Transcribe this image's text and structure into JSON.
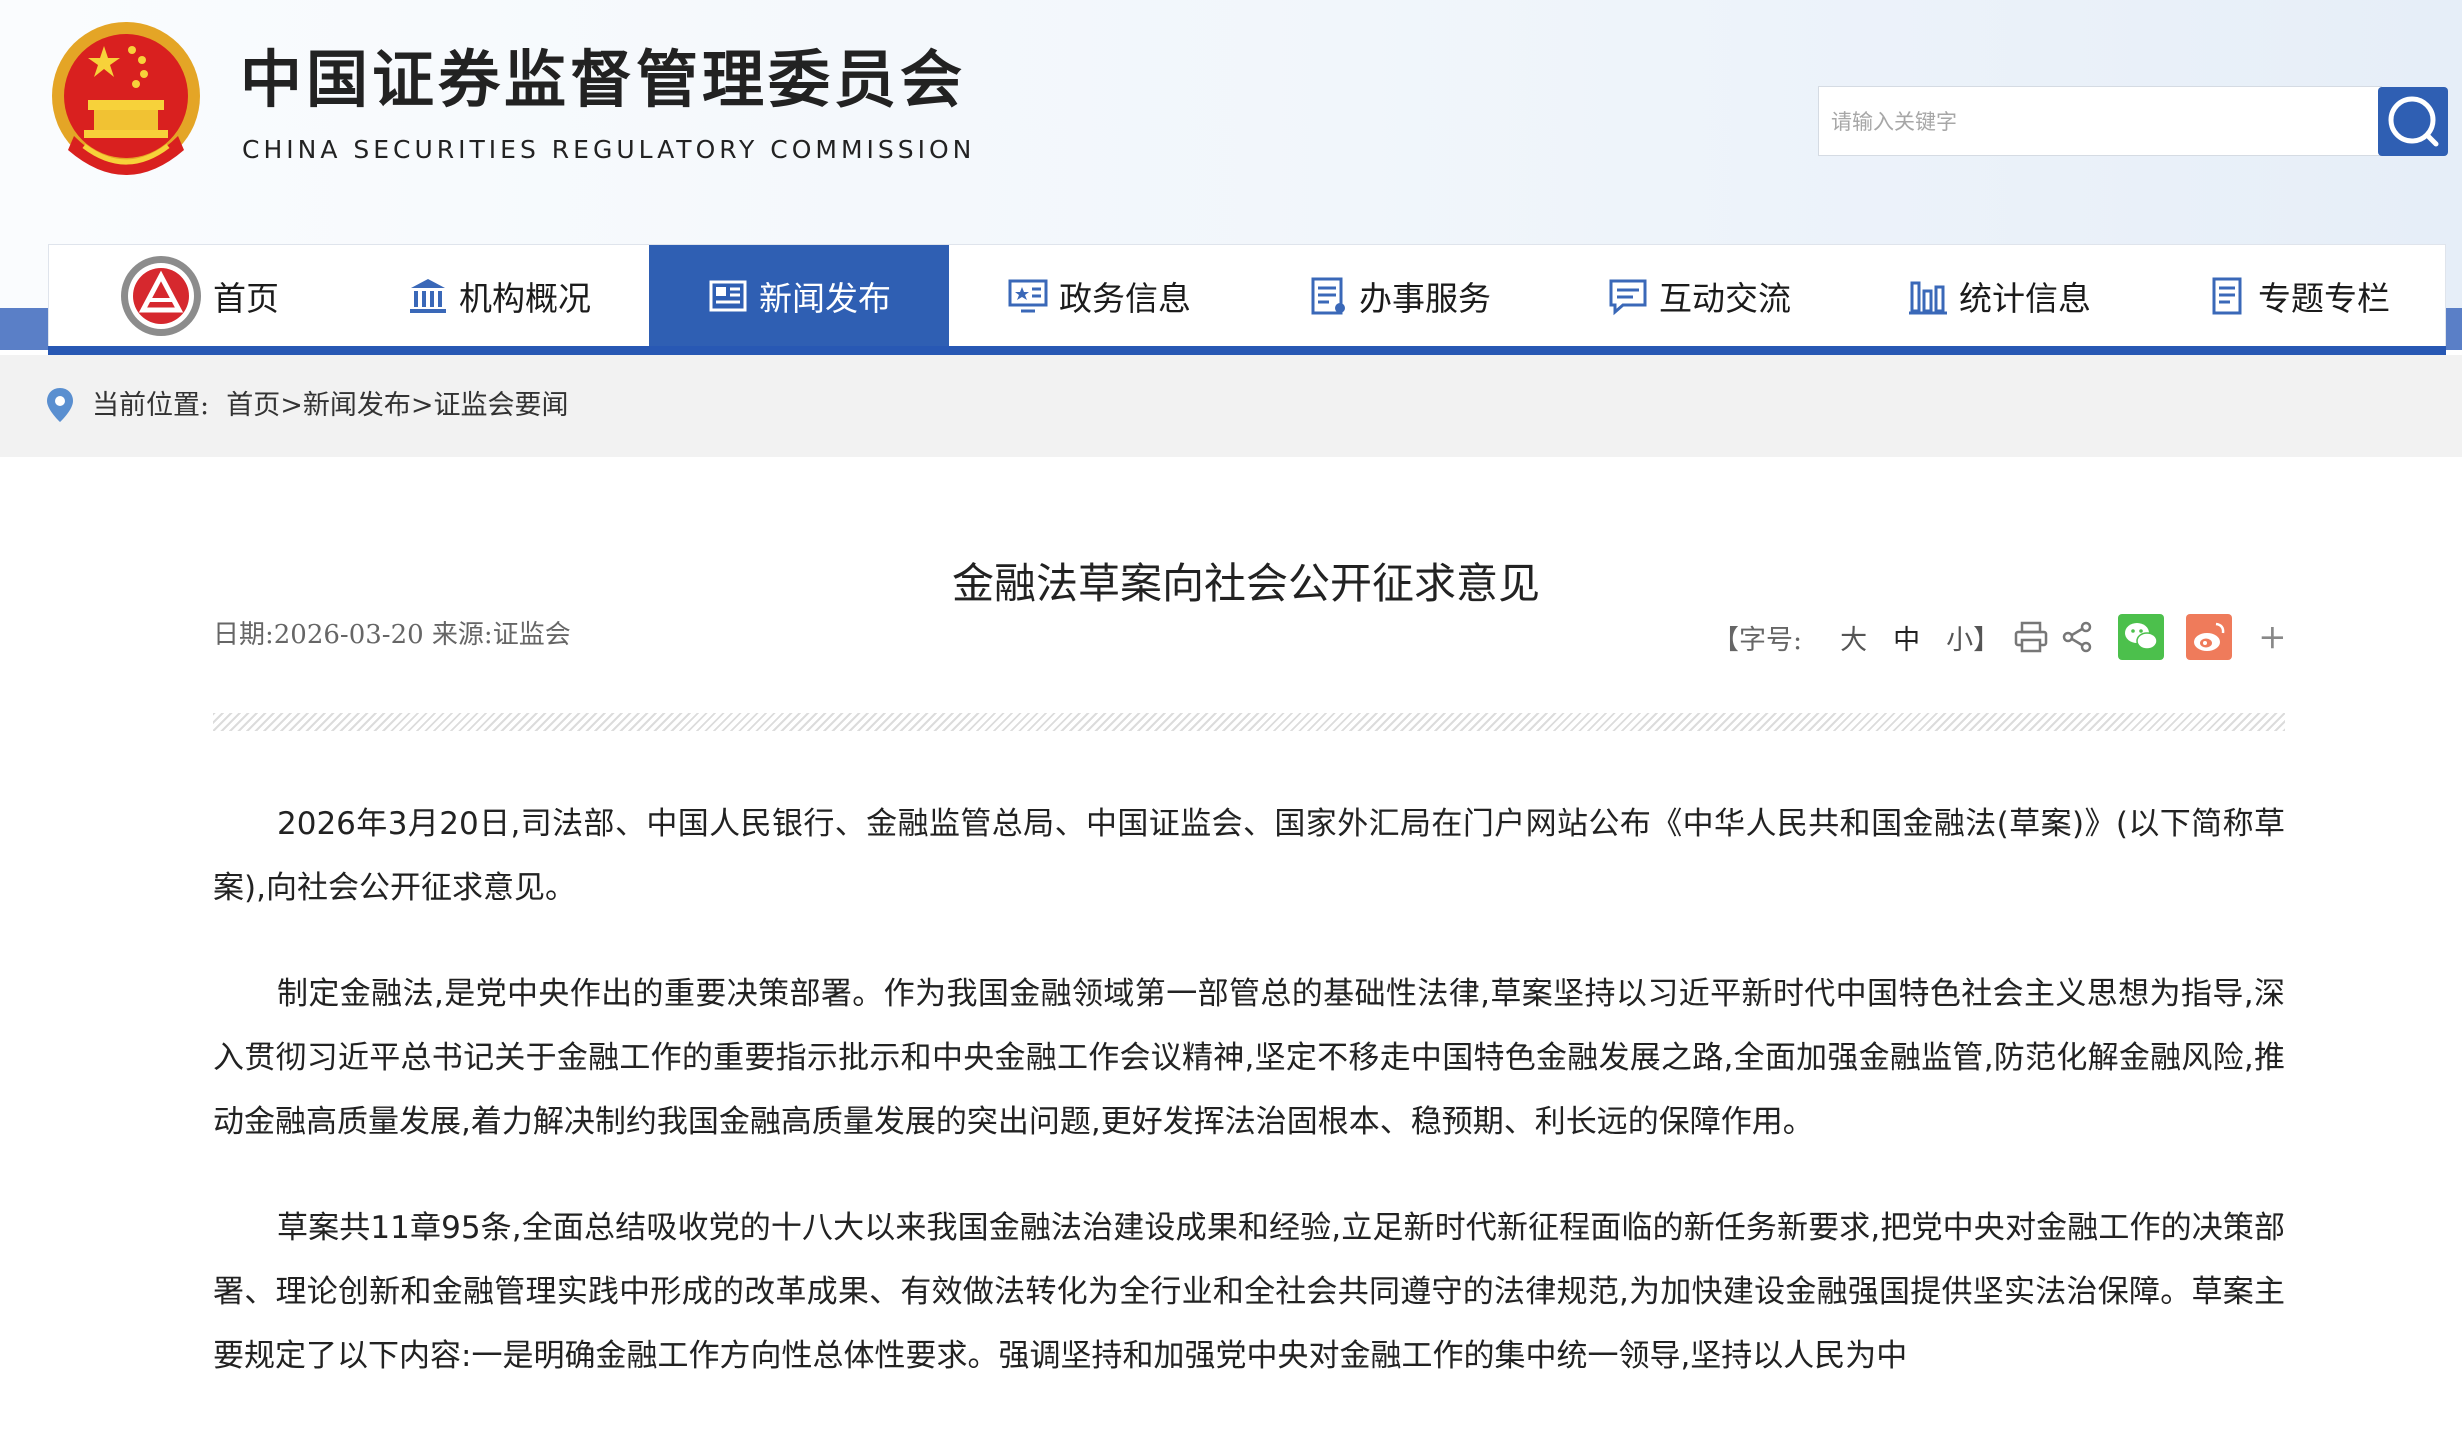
{
  "header": {
    "title": "中国证券监督管理委员会",
    "subtitle": "CHINA SECURITIES REGULATORY COMMISSION",
    "search_placeholder": "请输入关键字"
  },
  "nav": {
    "items": [
      {
        "label": "首页",
        "icon": "csrc-logo-icon"
      },
      {
        "label": "机构概况",
        "icon": "building-icon"
      },
      {
        "label": "新闻发布",
        "icon": "newspaper-icon",
        "active": true
      },
      {
        "label": "政务信息",
        "icon": "monitor-icon"
      },
      {
        "label": "办事服务",
        "icon": "document-list-icon"
      },
      {
        "label": "互动交流",
        "icon": "chat-bubble-icon"
      },
      {
        "label": "统计信息",
        "icon": "bar-chart-icon"
      },
      {
        "label": "专题专栏",
        "icon": "document-icon"
      }
    ],
    "active_color": "#2f5fb3"
  },
  "breadcrumb": {
    "label": "当前位置:",
    "path": "首页>新闻发布>证监会要闻"
  },
  "article": {
    "title": "金融法草案向社会公开征求意见",
    "meta": "日期:2026-03-20 来源:证监会",
    "font_size_label": "【字号:",
    "size_large": "大",
    "size_medium": "中",
    "size_small": "小】",
    "share_more": "+",
    "paragraphs": [
      "2026年3月20日,司法部、中国人民银行、金融监管总局、中国证监会、国家外汇局在门户网站公布《中华人民共和国金融法(草案)》(以下简称草案),向社会公开征求意见。",
      "制定金融法,是党中央作出的重要决策部署。作为我国金融领域第一部管总的基础性法律,草案坚持以习近平新时代中国特色社会主义思想为指导,深入贯彻习近平总书记关于金融工作的重要指示批示和中央金融工作会议精神,坚定不移走中国特色金融发展之路,全面加强金融监管,防范化解金融风险,推动金融高质量发展,着力解决制约我国金融高质量发展的突出问题,更好发挥法治固根本、稳预期、利长远的保障作用。",
      "草案共11章95条,全面总结吸收党的十八大以来我国金融法治建设成果和经验,立足新时代新征程面临的新任务新要求,把党中央对金融工作的决策部署、理论创新和金融管理实践中形成的改革成果、有效做法转化为全行业和全社会共同遵守的法律规范,为加快建设金融强国提供坚实法治保障。草案主要规定了以下内容:一是明确金融工作方向性总体性要求。强调坚持和加强党中央对金融工作的集中统一领导,坚持以人民为中"
    ]
  },
  "colors": {
    "nav_band": "#5a7fc7",
    "nav_underline": "#2858b4",
    "wechat_green": "#4cc04c",
    "weibo_orange": "#ef7b5b"
  }
}
